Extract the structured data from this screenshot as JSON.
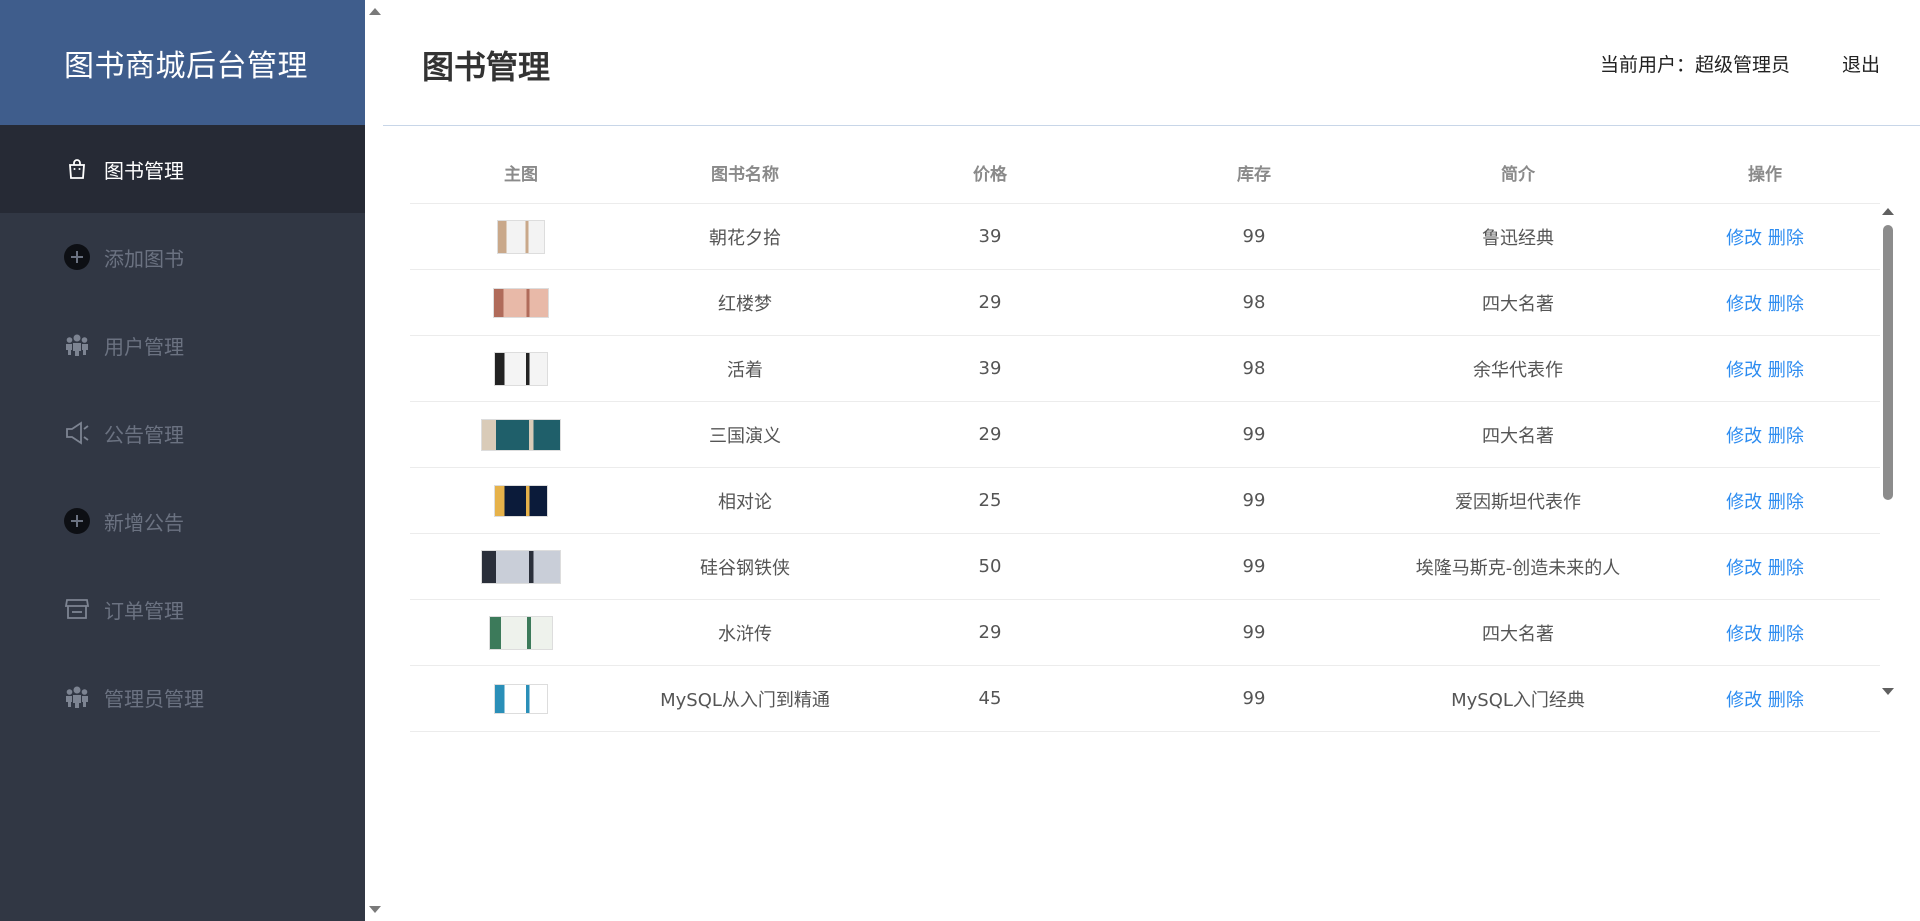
{
  "sidebar": {
    "brand": "图书商城后台管理",
    "items": [
      {
        "label": "图书管理",
        "icon": "shopping-bag-icon",
        "active": true
      },
      {
        "label": "添加图书",
        "icon": "add-circle-icon",
        "active": false
      },
      {
        "label": "用户管理",
        "icon": "users-icon",
        "active": false
      },
      {
        "label": "公告管理",
        "icon": "megaphone-icon",
        "active": false
      },
      {
        "label": "新增公告",
        "icon": "add-circle-icon",
        "active": false
      },
      {
        "label": "订单管理",
        "icon": "store-icon",
        "active": false
      },
      {
        "label": "管理员管理",
        "icon": "users-icon",
        "active": false
      }
    ]
  },
  "header": {
    "title": "图书管理",
    "user_label": "当前用户：超级管理员",
    "logout": "退出"
  },
  "table": {
    "columns": [
      "主图",
      "图书名称",
      "价格",
      "库存",
      "简介",
      "操作"
    ],
    "edit_label": "修改",
    "delete_label": "删除",
    "rows": [
      {
        "name": "朝花夕拾",
        "price": "39",
        "stock": "99",
        "intro": "鲁迅经典",
        "cover": "book-cover-chaohua"
      },
      {
        "name": "红楼梦",
        "price": "29",
        "stock": "98",
        "intro": "四大名著",
        "cover": "book-cover-hongloumeng"
      },
      {
        "name": "活着",
        "price": "39",
        "stock": "98",
        "intro": "余华代表作",
        "cover": "book-cover-huozhe"
      },
      {
        "name": "三国演义",
        "price": "29",
        "stock": "99",
        "intro": "四大名著",
        "cover": "book-cover-sanguo"
      },
      {
        "name": "相对论",
        "price": "25",
        "stock": "99",
        "intro": "爱因斯坦代表作",
        "cover": "book-cover-xiangduilun"
      },
      {
        "name": "硅谷钢铁侠",
        "price": "50",
        "stock": "99",
        "intro": "埃隆马斯克-创造未来的人",
        "cover": "book-cover-musk"
      },
      {
        "name": "水浒传",
        "price": "29",
        "stock": "99",
        "intro": "四大名著",
        "cover": "book-cover-shuihu"
      },
      {
        "name": "MySQL从入门到精通",
        "price": "45",
        "stock": "99",
        "intro": "MySQL入门经典",
        "cover": "book-cover-mysql"
      }
    ]
  },
  "colors": {
    "sidebar_bg": "#313744",
    "brand_bg": "#3f5d8c",
    "active_item_bg": "#262a35",
    "link": "#2d8cf0"
  }
}
